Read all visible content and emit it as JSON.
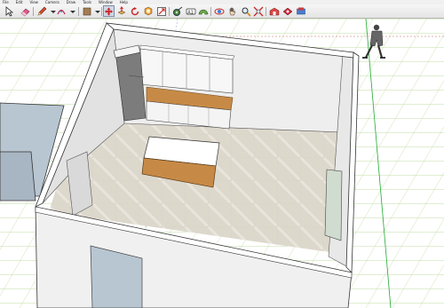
{
  "menu": [
    "File",
    "Edit",
    "View",
    "Camera",
    "Draw",
    "Tools",
    "Window",
    "Help"
  ],
  "toolbar_icons": [
    "select-icon",
    "eraser-icon",
    "pencil-icon",
    "arc-icon",
    "paint-bucket-icon",
    "move-icon",
    "push-pull-icon",
    "rotate-icon",
    "offset-icon",
    "tape-measure-icon",
    "protractor-icon",
    "text-icon",
    "orbit-icon",
    "pan-icon",
    "zoom-icon",
    "zoom-extents-icon",
    "warehouse-icon",
    "share-model-icon",
    "components-icon"
  ],
  "colors": {
    "background": "#ffffff",
    "grid_line": "#99cc66",
    "axis_red": "#cc2222",
    "axis_green": "#22aa33",
    "axis_blue": "#3344cc",
    "wall_fill": "#f2f2f2",
    "floor_fill": "#dedad0",
    "countertop": "#c78a46",
    "cabinet": "#f7f7f7",
    "adjacent_wall": "#b8c6d2"
  },
  "scene": {
    "description_items": [
      "room-walls",
      "floor",
      "kitchen-cabinets",
      "refrigerator",
      "kitchen-island",
      "door",
      "window",
      "scale-figure"
    ]
  }
}
